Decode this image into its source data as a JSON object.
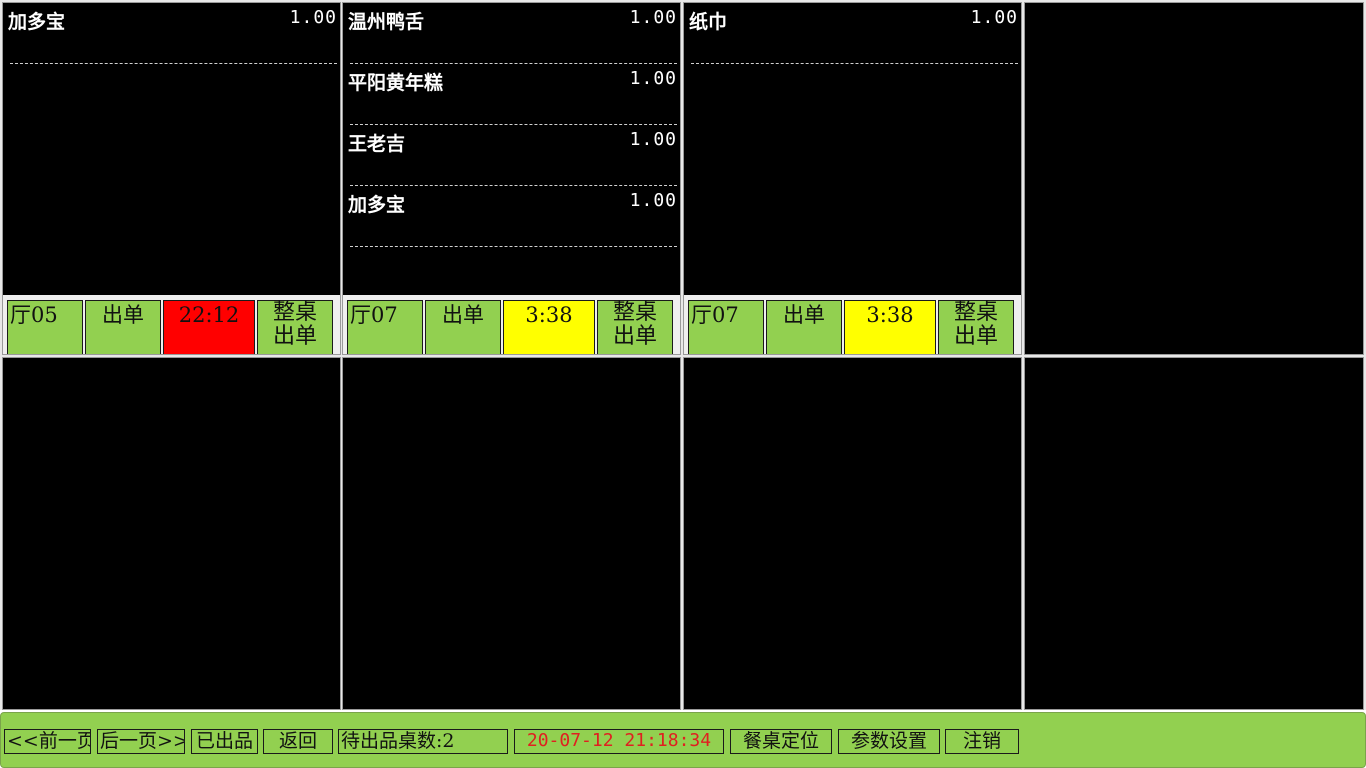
{
  "colors": {
    "panel_bg": "#000000",
    "button_green": "#92d050",
    "time_overdue": "#ff0000",
    "time_warning": "#ffff00",
    "footer_time_text": "#e02020"
  },
  "panels": [
    {
      "items": [
        {
          "name": "加多宝",
          "qty": "1.00"
        }
      ],
      "table": "厅05",
      "serve_label": "出单",
      "time": "22:12",
      "time_color": "#ff0000",
      "whole_line1": "整桌",
      "whole_line2": "出单"
    },
    {
      "items": [
        {
          "name": "温州鸭舌",
          "qty": "1.00"
        },
        {
          "name": "平阳黄年糕",
          "qty": "1.00"
        },
        {
          "name": "王老吉",
          "qty": "1.00"
        },
        {
          "name": "加多宝",
          "qty": "1.00"
        }
      ],
      "table": "厅07",
      "serve_label": "出单",
      "time": "3:38",
      "time_color": "#ffff00",
      "whole_line1": "整桌",
      "whole_line2": "出单"
    },
    {
      "items": [
        {
          "name": "纸巾",
          "qty": "1.00"
        }
      ],
      "table": "厅07",
      "serve_label": "出单",
      "time": "3:38",
      "time_color": "#ffff00",
      "whole_line1": "整桌",
      "whole_line2": "出单"
    }
  ],
  "footer": {
    "prev_page": "<<前一页",
    "next_page": "后一页>>",
    "served": "已出品",
    "back": "返回",
    "pending_tables": "待出品桌数:2",
    "datetime": "20-07-12 21:18:34",
    "locate_table": "餐桌定位",
    "settings": "参数设置",
    "logout": "注销"
  }
}
